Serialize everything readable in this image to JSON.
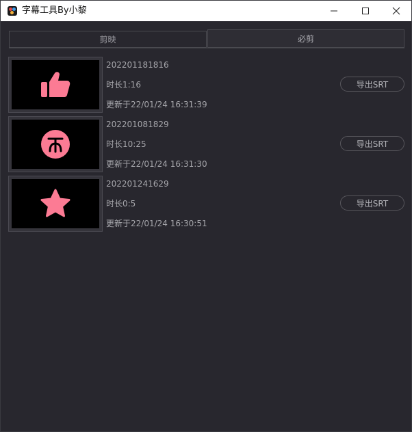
{
  "window": {
    "title": "字幕工具By小黎"
  },
  "tabs": [
    {
      "label": "剪映"
    },
    {
      "label": "必剪"
    }
  ],
  "projects": [
    {
      "name": "202201181816",
      "duration": "时长1:16",
      "updated": "更新于22/01/24 16:31:39",
      "export_label": "导出SRT",
      "thumb_icon": "thumbs-up-icon"
    },
    {
      "name": "202201081829",
      "duration": "时长10:25",
      "updated": "更新于22/01/24 16:31:30",
      "export_label": "导出SRT",
      "thumb_icon": "coin-icon"
    },
    {
      "name": "202201241629",
      "duration": "时长0:5",
      "updated": "更新于22/01/24 16:30:51",
      "export_label": "导出SRT",
      "thumb_icon": "star-icon"
    }
  ],
  "colors": {
    "accent": "#fc7b94",
    "background": "#28272e"
  }
}
